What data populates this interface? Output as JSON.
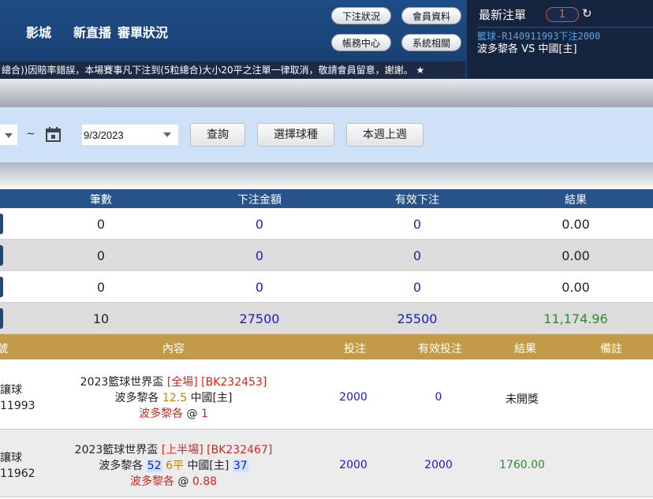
{
  "header": {
    "nav": [
      "影城",
      "新直播",
      "審單狀況"
    ],
    "buttons": {
      "bet_status": "下注狀況",
      "member_info": "會員資料",
      "account_center": "帳務中心",
      "system": "系統相關"
    },
    "marquee": "總合))因賠率錯誤，本場賽事凡下注到(5粒總合)大小20平之注單一律取消，敬請會員留意，謝謝。 ★"
  },
  "latest_bets": {
    "title": "最新注單",
    "count": "1",
    "refresh_icon": "refresh-icon",
    "link": "籃球-R140911993下注2000",
    "match": "波多黎各 VS 中國[主]"
  },
  "search": {
    "tilde": "~",
    "calendar_icon": "calendar-icon",
    "end_date": "9/3/2023",
    "query_btn": "查詢",
    "select_sport_btn": "選擇球種",
    "week_btn": "本週上週"
  },
  "summary": {
    "headers": [
      "筆數",
      "下注金額",
      "有效下注",
      "結果"
    ],
    "rows": [
      {
        "count": "0",
        "amount": "0",
        "valid": "0",
        "result": "0.00"
      },
      {
        "count": "0",
        "amount": "0",
        "valid": "0",
        "result": "0.00"
      },
      {
        "count": "0",
        "amount": "0",
        "valid": "0",
        "result": "0.00"
      },
      {
        "count": "10",
        "amount": "27500",
        "valid": "25500",
        "result": "11,174.96"
      }
    ]
  },
  "details": {
    "headers": {
      "no": "號",
      "content": "內容",
      "stake": "投注",
      "valid_stake": "有效投注",
      "result": "結果",
      "remark": "備註"
    },
    "rows": [
      {
        "type": "讓球",
        "id": "11993",
        "league": "2023籃球世界盃",
        "period": "[全場]",
        "code": "[BK232453]",
        "home": "波多黎各",
        "home_score": "",
        "line": "12.5",
        "away": "中國[主]",
        "away_score": "",
        "pick": "波多黎各",
        "at": "@",
        "odds": "1",
        "stake": "2000",
        "valid": "0",
        "result": "未開獎"
      },
      {
        "type": "讓球",
        "id": "11962",
        "league": "2023籃球世界盃",
        "period": "[上半場]",
        "code": "[BK232467]",
        "home": "波多黎各",
        "home_score": "52",
        "line": "6平",
        "away": "中國[主]",
        "away_score": "37",
        "pick": "波多黎各",
        "at": "@",
        "odds": "0.88",
        "stake": "2000",
        "valid": "2000",
        "result": "1760.00"
      }
    ]
  }
}
